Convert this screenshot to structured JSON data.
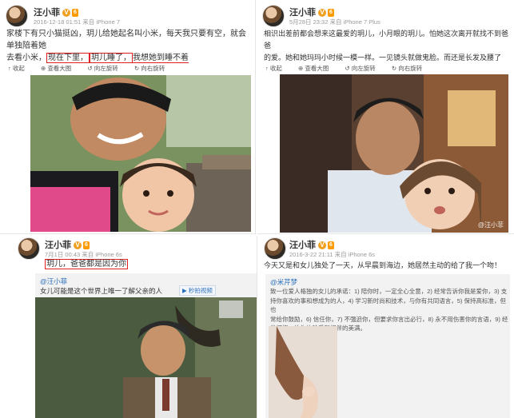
{
  "panel1": {
    "username": "汪小菲",
    "badge_v": "V",
    "badge_level": "6",
    "meta": "2016-12-18 01:51 来自 iPhone 7",
    "line1": "家楼下有只小猫挺凶，玥儿给她起名叫小米，每天我只要有空，就会单独陪着她",
    "line2_prefix": "去看小米，",
    "line2_hl1": "现在下里，",
    "line2_hl2": "玥儿睡了，",
    "line2_hl3": "我想她到睡不着",
    "toolbar": [
      "收起",
      "查看大图",
      "向左旋转",
      "向右旋转"
    ]
  },
  "panel2": {
    "username": "汪小菲",
    "badge_v": "V",
    "badge_level": "6",
    "meta": "5月28日 23:32 来自 iPhone 7 Plus",
    "line1": "相识出差前都会想来这最爱的玥儿，小月眼的玥儿。怕她这次离开就找不到爸爸",
    "line2": "的爱。她和她玛玛小时候一模一样。一见镜头就做鬼脸。而还是长发及腰了",
    "toolbar": [
      "收起",
      "查看大图",
      "向左旋转",
      "向右旋转"
    ],
    "watermark": "@汪小菲"
  },
  "panel3": {
    "username": "汪小菲",
    "badge_v": "V",
    "badge_level": "6",
    "meta": "7月1日 00:43 来自 iPhone 6s",
    "post": "玥儿，爸爸都是因为你",
    "quote_user": "@汪小菲",
    "quote_text": "女儿可能是这个世界上唯一了解父亲的人",
    "quote_tag": "秒拍视频"
  },
  "panel4": {
    "username": "汪小菲",
    "badge_v": "V",
    "badge_level": "6",
    "meta": "2016-3-22 21:11 来自 iPhone 6s",
    "post": "今天又是和女儿独处了一天，从早晨到海边，她居然主动的给了我一个吻！",
    "quote_user": "@米芹梦",
    "list": [
      "致一位爱人格独的女儿的承诺：1) 陪你时，一定全心全意，2) 经常告诉你我是爱你，3) 支",
      "持你喜欢的事和想成为的人，4) 学习新时尚和技术，与你有共同语言，5) 保持高标准，但也",
      "常给你鼓励，6) 信任你，7) 不强迫你，但要求你言出必行，8) 永不用伤害你的言语，9) 经",
      "常拥抱，让你体验爱和相伴的美满。"
    ]
  }
}
